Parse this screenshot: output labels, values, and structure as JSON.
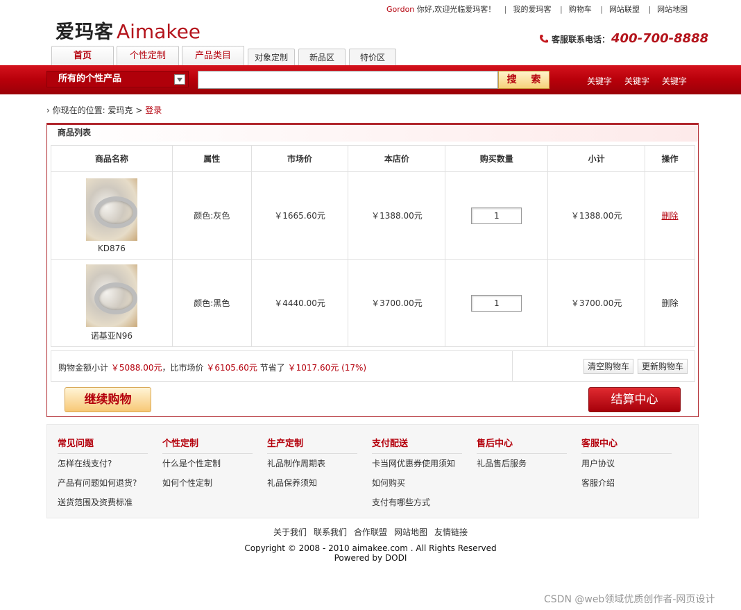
{
  "top_links": {
    "username": "Gordon",
    "greeting": "你好,欢迎光临爱玛客！",
    "my_account": "我的爱玛客",
    "cart": "购物车",
    "alliance": "网站联盟",
    "sitemap": "网站地图"
  },
  "logo": {
    "cn": "爱玛客",
    "en": "Aimakee"
  },
  "hotline": {
    "label": "客服联系电话：",
    "phone": "400-700-8888"
  },
  "tabs": [
    "首页",
    "个性定制",
    "产品类目",
    "对象定制",
    "新品区",
    "特价区"
  ],
  "search": {
    "category": "所有的个性产品",
    "placeholder": "",
    "button": "搜 索",
    "keywords": [
      "关键字",
      "关键字",
      "关键字"
    ]
  },
  "breadcrumb": {
    "prefix": "你现在的位置:",
    "home": "爱玛克",
    "sep": ">",
    "current": "登录"
  },
  "cart": {
    "title": "商品列表",
    "headers": [
      "商品名称",
      "属性",
      "市场价",
      "本店价",
      "购买数量",
      "小计",
      "操作"
    ],
    "rows": [
      {
        "name": "KD876",
        "attr": "颜色:灰色",
        "market": "￥1665.60元",
        "price": "￥1388.00元",
        "qty": "1",
        "subtotal": "￥1388.00元",
        "action": "删除"
      },
      {
        "name": "诺基亚N96",
        "attr": "颜色:黑色",
        "market": "￥4440.00元",
        "price": "￥3700.00元",
        "qty": "1",
        "subtotal": "￥3700.00元",
        "action": "删除"
      }
    ],
    "summary": {
      "label1": "购物金额小计",
      "total": "￥5088.00元",
      "label2": "，比市场价",
      "market_total": "￥6105.60元",
      "label3": "节省了",
      "saved": "￥1017.60元",
      "percent": "(17%)"
    },
    "clear_btn": "清空购物车",
    "update_btn": "更新购物车",
    "continue_btn": "继续购物",
    "checkout_btn": "结算中心"
  },
  "help": [
    {
      "title": "常见问题",
      "links": [
        "怎样在线支付?",
        "产品有问题如何退货?",
        "送货范围及资费标准"
      ]
    },
    {
      "title": "个性定制",
      "links": [
        "什么是个性定制",
        "如何个性定制"
      ]
    },
    {
      "title": "生产定制",
      "links": [
        "礼品制作周期表",
        "礼品保养须知"
      ]
    },
    {
      "title": "支付配送",
      "links": [
        "卡当网优惠券使用须知",
        "如何购买",
        "支付有哪些方式"
      ]
    },
    {
      "title": "售后中心",
      "links": [
        "礼品售后服务"
      ]
    },
    {
      "title": "客服中心",
      "links": [
        "用户协议",
        "客服介绍"
      ]
    }
  ],
  "footer_links": [
    "关于我们",
    "联系我们",
    "合作联盟",
    "网站地图",
    "友情链接"
  ],
  "copyright": "Copyright © 2008 - 2010 aimakee.com . All Rights Reserved",
  "powered": "Powered by DODI",
  "watermark": "CSDN @web领域优质创作者-网页设计",
  "colors": {
    "brand_red": "#b4000c",
    "bar_red": "#c40812"
  }
}
